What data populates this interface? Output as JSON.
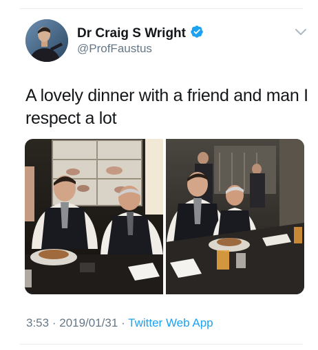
{
  "tweet": {
    "author": {
      "display_name": "Dr Craig S Wright",
      "handle": "@ProfFaustus",
      "verified": true
    },
    "text": "A lovely dinner with a friend and man I respect a lot",
    "media": [
      {
        "subject": "dinner-photo-left"
      },
      {
        "subject": "dinner-photo-right"
      }
    ],
    "time": "3:53",
    "separator": "·",
    "date": "2019/01/31",
    "source_app": "Twitter Web App"
  },
  "icons": {
    "verified": "verified-badge-icon",
    "menu": "chevron-down-icon"
  },
  "colors": {
    "verified": "#1da1f2",
    "link": "#1da1f2",
    "secondary_text": "#657786"
  }
}
